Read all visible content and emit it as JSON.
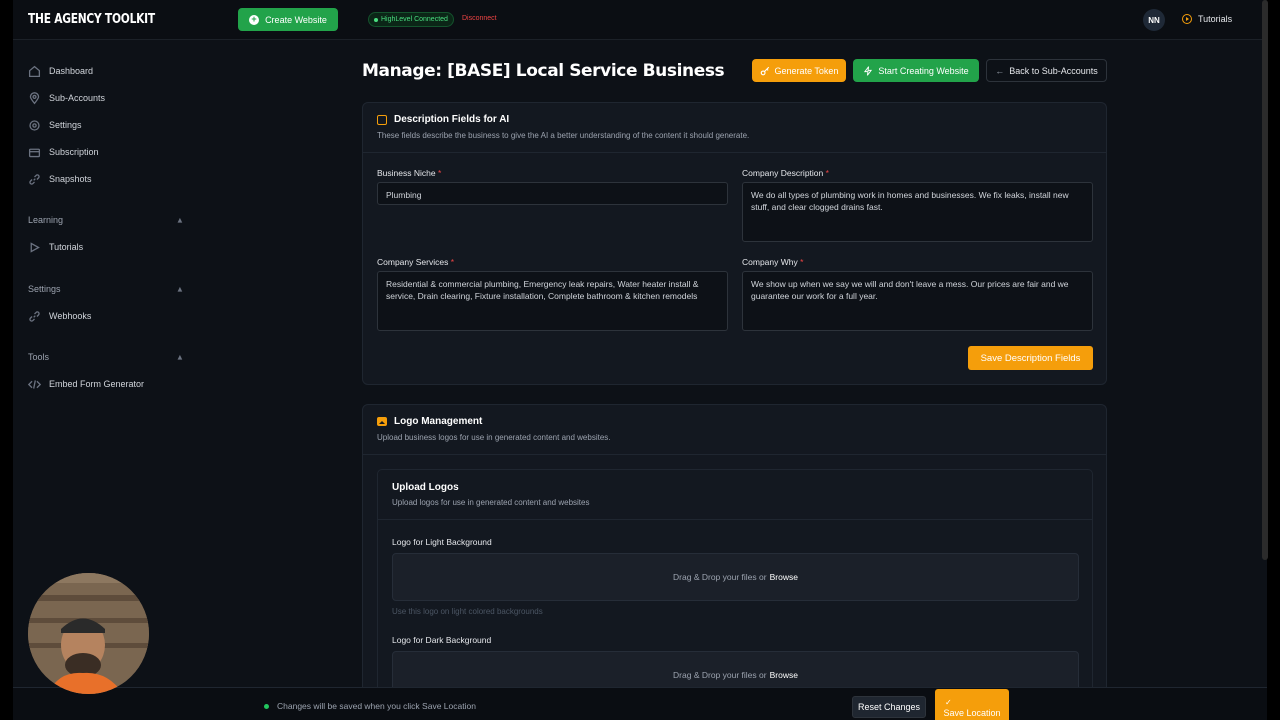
{
  "app": {
    "logo": "THE AGENCY TOOLKIT"
  },
  "topbar": {
    "create_label": "Create Website",
    "connection_status": "HighLevel Connected",
    "disconnect_label": "Disconnect",
    "user_initials": "NN",
    "tutorials_label": "Tutorials"
  },
  "sidebar": {
    "items": [
      {
        "label": "Dashboard",
        "icon": "home-icon"
      },
      {
        "label": "Sub-Accounts",
        "icon": "map-pin-icon"
      },
      {
        "label": "Settings",
        "icon": "gear-icon"
      },
      {
        "label": "Subscription",
        "icon": "credit-card-icon"
      },
      {
        "label": "Snapshots",
        "icon": "link-icon"
      }
    ],
    "sections": [
      {
        "title": "Learning",
        "items": [
          {
            "label": "Tutorials",
            "icon": "play-icon"
          }
        ]
      },
      {
        "title": "Settings",
        "items": [
          {
            "label": "Webhooks",
            "icon": "webhook-icon"
          }
        ]
      },
      {
        "title": "Tools",
        "items": [
          {
            "label": "Embed Form Generator",
            "icon": "code-icon"
          }
        ]
      }
    ]
  },
  "page": {
    "title": "Manage: [BASE] Local Service Business",
    "generate_token_label": "Generate Token",
    "start_creating_label": "Start Creating Website",
    "back_label": "Back to Sub-Accounts"
  },
  "description_card": {
    "title": "Description Fields for AI",
    "subtitle": "These fields describe the business to give the AI a better understanding of the content it should generate.",
    "business_niche_label": "Business Niche",
    "business_niche_value": "Plumbing",
    "company_description_label": "Company Description",
    "company_description_value": "We do all types of plumbing work in homes and businesses. We fix leaks, install new stuff, and clear clogged drains fast.",
    "company_services_label": "Company Services",
    "company_services_value": "Residential & commercial plumbing, Emergency leak repairs, Water heater install & service, Drain clearing, Fixture installation, Complete bathroom & kitchen remodels",
    "company_why_label": "Company Why",
    "company_why_value": "We show up when we say we will and don't leave a mess. Our prices are fair and we guarantee our work for a full year.",
    "required_mark": "*",
    "save_label": "Save Description Fields"
  },
  "logo_card": {
    "title": "Logo Management",
    "subtitle": "Upload business logos for use in generated content and websites.",
    "upload_title": "Upload Logos",
    "upload_subtitle": "Upload logos for use in generated content and websites",
    "light_label": "Logo for Light Background",
    "dark_label": "Logo for Dark Background",
    "drop_text": "Drag & Drop your files or",
    "browse_label": "Browse",
    "light_hint": "Use this logo on light colored backgrounds"
  },
  "bottom_bar": {
    "note": "Changes will be saved when you click Save Location",
    "reset_label": "Reset Changes",
    "save_label": "Save Location",
    "check": "✓"
  },
  "colors": {
    "accent_orange": "#f59e0b",
    "accent_green": "#22a34a",
    "background": "#0d1117",
    "card": "#131820"
  }
}
